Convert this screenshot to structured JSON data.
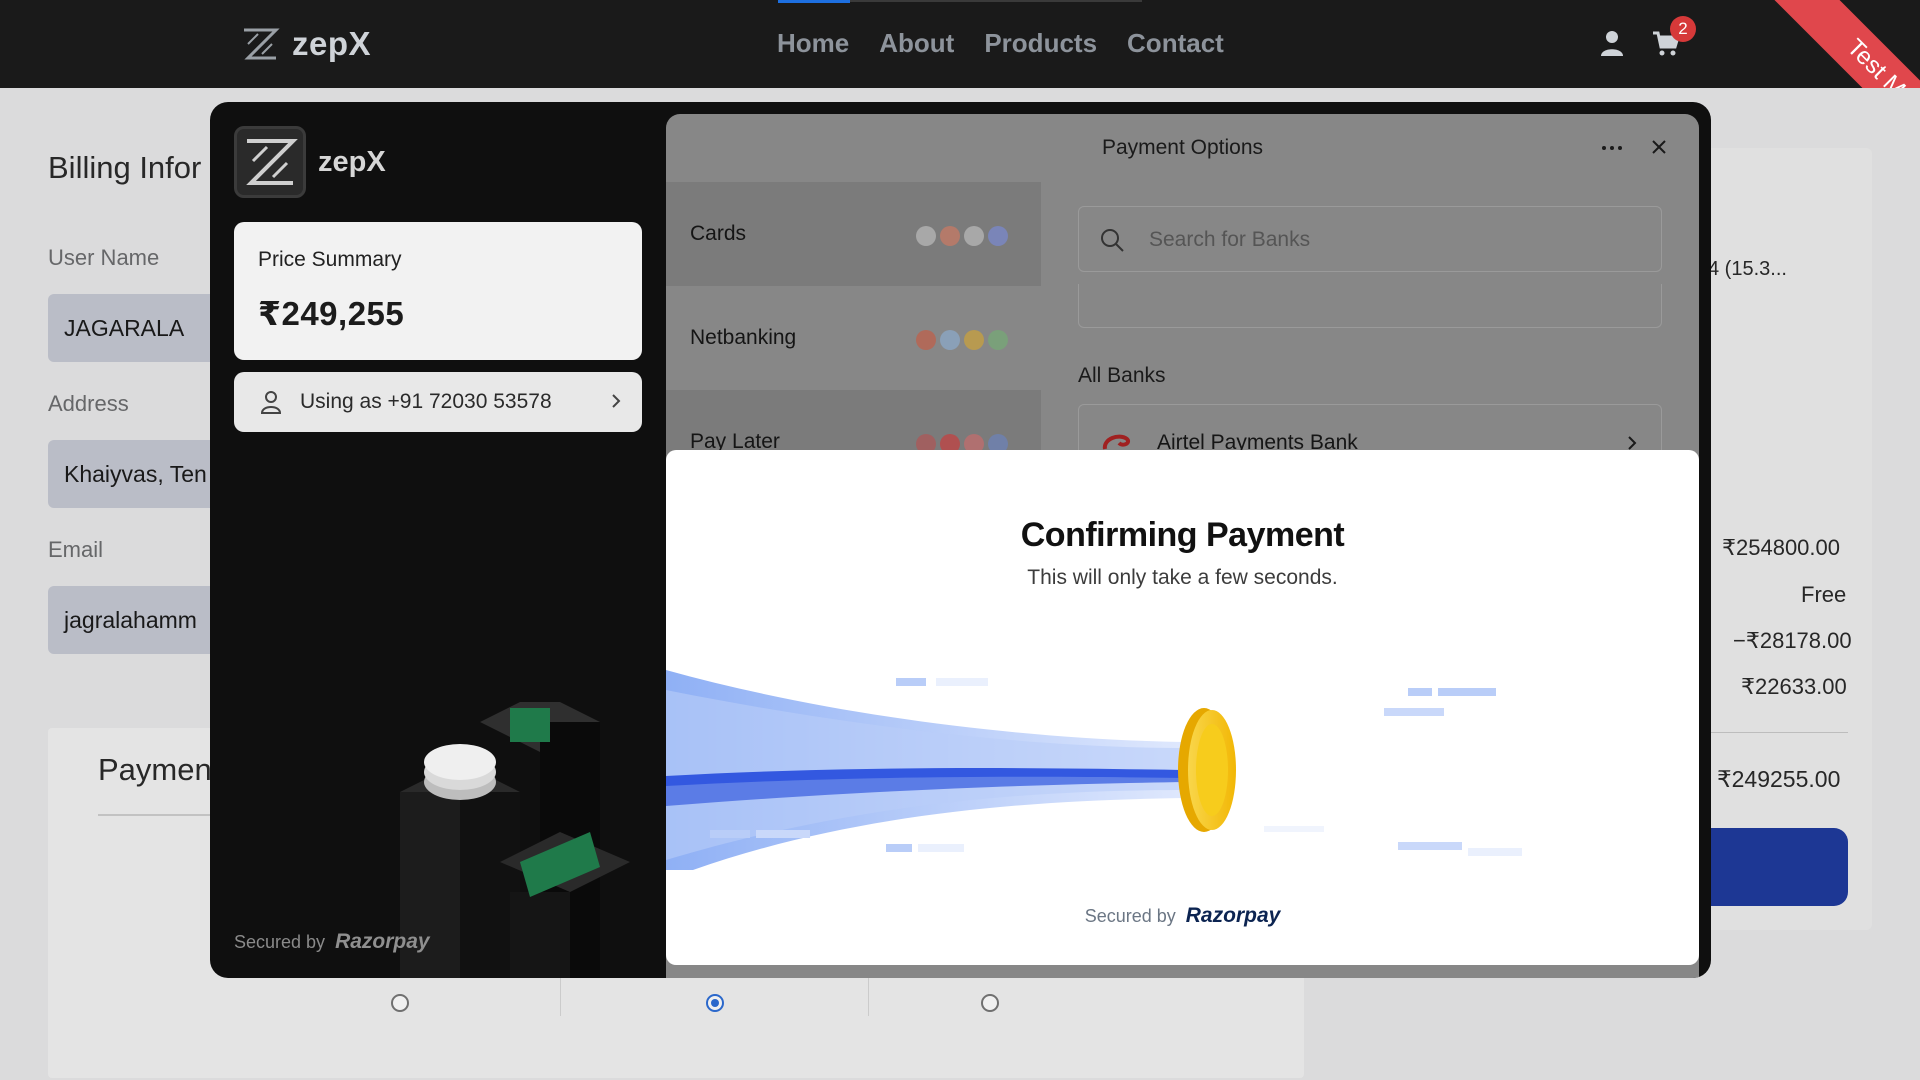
{
  "navbar": {
    "brand": "zepX",
    "links": [
      "Home",
      "About",
      "Products",
      "Contact"
    ],
    "cart_count": "2",
    "ribbon": "Test Mode"
  },
  "billing": {
    "title": "Billing Infor",
    "fields": [
      {
        "label": "User Name",
        "value": "JAGARALA"
      },
      {
        "label": "Address",
        "value": "Khaiyvas, Ten"
      },
      {
        "label": "Email",
        "value": "jagralahamm"
      }
    ]
  },
  "payment_section": {
    "title": "Paymen",
    "selected_index": 1
  },
  "order_summary": {
    "product_snippet": "4 (15.3...",
    "subtotal": "₹254800.00",
    "shipping": "Free",
    "discount": "−₹28178.00",
    "tax": "₹22633.00",
    "total": "₹249255.00"
  },
  "checkout": {
    "merchant_name": "zepX",
    "price_summary_label": "Price Summary",
    "price_summary_value": "₹249,255",
    "user_label": "Using as +91 72030 53578",
    "secured_by": "Secured by",
    "secured_brand": "Razorpay",
    "options_title": "Payment Options",
    "methods": [
      {
        "label": "Cards",
        "icons": [
          "visa-icon",
          "mastercard-icon",
          "rupay-icon",
          "maestro-icon"
        ]
      },
      {
        "label": "Netbanking",
        "icons": [
          "bank-icon",
          "bank-icon",
          "bank-icon",
          "bank-icon"
        ]
      },
      {
        "label": "Pay Later",
        "icons": [
          "paylater-icon",
          "paylater-icon",
          "paylater-icon",
          "paylater-icon"
        ]
      }
    ],
    "search_placeholder": "Search for Banks",
    "all_banks_label": "All Banks",
    "banks": [
      {
        "name": "Airtel Payments Bank"
      }
    ]
  },
  "confirm_dialog": {
    "title": "Confirming Payment",
    "subtitle": "This will only take a few seconds.",
    "secured_by": "Secured by",
    "secured_brand": "Razorpay"
  },
  "colors": {
    "navbar_bg": "#1a1a1a",
    "accent": "#1d6fe0",
    "badge": "#d63939",
    "ribbon": "#e0474c",
    "coin": "#f5c518",
    "beam_blue": "#3358e0"
  }
}
